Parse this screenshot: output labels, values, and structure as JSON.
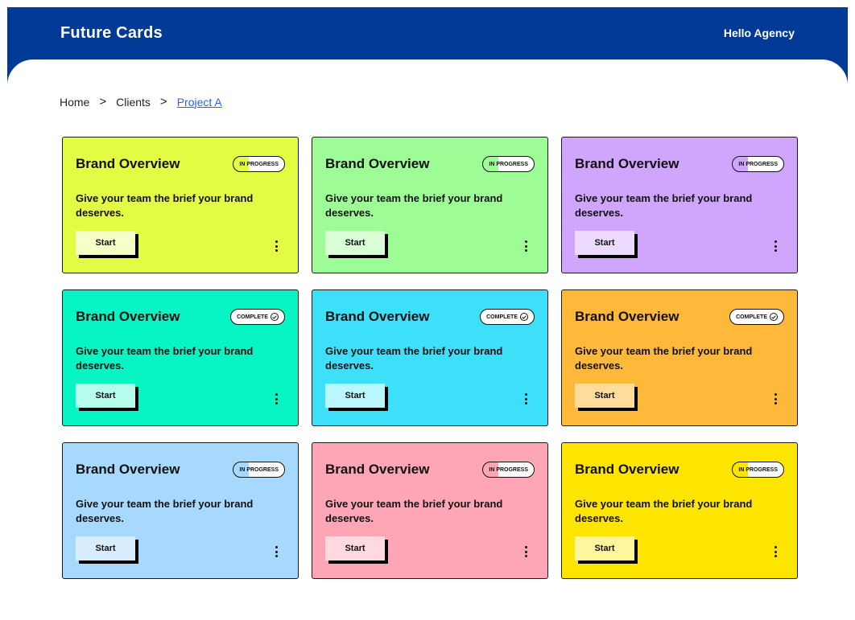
{
  "header": {
    "brand": "Future Cards",
    "greeting": "Hello Agency"
  },
  "breadcrumb": {
    "items": [
      "Home",
      "Clients",
      "Project A"
    ],
    "separator": ">"
  },
  "colors": {
    "header_bg": "#003a96",
    "link": "#2a63e6"
  },
  "cards": [
    {
      "title": "Brand Overview",
      "status": "IN PROGRESS",
      "description": "Give your team the brief your brand deserves.",
      "button": "Start",
      "bg": "#e4fb43",
      "button_bg": "#f6ffc7",
      "tint": "#e4fb43"
    },
    {
      "title": "Brand Overview",
      "status": "IN PROGRESS",
      "description": "Give your team the brief your brand deserves.",
      "button": "Start",
      "bg": "#9efc96",
      "button_bg": "#d9fdd5",
      "tint": "#9efc96"
    },
    {
      "title": "Brand Overview",
      "status": "IN PROGRESS",
      "description": "Give your team the brief your brand deserves.",
      "button": "Start",
      "bg": "#cfa5fd",
      "button_bg": "#ecdaff",
      "tint": "#cfa5fd"
    },
    {
      "title": "Brand Overview",
      "status": "COMPLETE",
      "description": "Give your team the brief your brand deserves.",
      "button": "Start",
      "bg": "#07f4c3",
      "button_bg": "#b6fcec",
      "tint": "#07f4c3"
    },
    {
      "title": "Brand Overview",
      "status": "COMPLETE",
      "description": "Give your team the brief your brand deserves.",
      "button": "Start",
      "bg": "#3ee0f9",
      "button_bg": "#b9f6fe",
      "tint": "#3ee0f9"
    },
    {
      "title": "Brand Overview",
      "status": "COMPLETE",
      "description": "Give your team the brief your brand deserves.",
      "button": "Start",
      "bg": "#feb83a",
      "button_bg": "#ffdc9a",
      "tint": "#feb83a"
    },
    {
      "title": "Brand Overview",
      "status": "IN PROGRESS",
      "description": "Give your team the brief your brand deserves.",
      "button": "Start",
      "bg": "#a7d9fe",
      "button_bg": "#d8eeff",
      "tint": "#a7d9fe"
    },
    {
      "title": "Brand Overview",
      "status": "IN PROGRESS",
      "description": "Give your team the brief your brand deserves.",
      "button": "Start",
      "bg": "#fea6b6",
      "button_bg": "#ffd9e0",
      "tint": "#fea6b6"
    },
    {
      "title": "Brand Overview",
      "status": "IN PROGRESS",
      "description": "Give your team the brief your brand deserves.",
      "button": "Start",
      "bg": "#fee500",
      "button_bg": "#fff59c",
      "tint": "#fee500"
    }
  ]
}
